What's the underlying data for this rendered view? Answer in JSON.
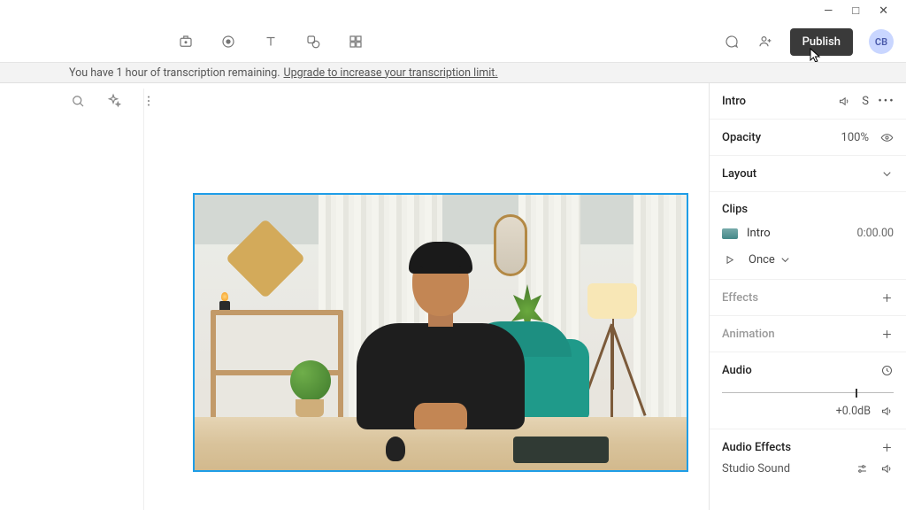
{
  "topbar": {
    "publish_label": "Publish",
    "avatar_initials": "CB"
  },
  "banner": {
    "text": "You have 1 hour of transcription remaining.",
    "link": "Upgrade to increase your transcription limit."
  },
  "inspector": {
    "title": "Intro",
    "shortcut": "S",
    "opacity": {
      "label": "Opacity",
      "value": "100%"
    },
    "layout": {
      "label": "Layout"
    },
    "clips": {
      "header": "Clips",
      "item_name": "Intro",
      "item_time": "0:00.00",
      "play_mode": "Once"
    },
    "effects": {
      "label": "Effects"
    },
    "animation": {
      "label": "Animation"
    },
    "audio": {
      "label": "Audio",
      "gain": "+0.0dB"
    },
    "audio_effects": {
      "label": "Audio Effects",
      "item": "Studio Sound"
    }
  }
}
